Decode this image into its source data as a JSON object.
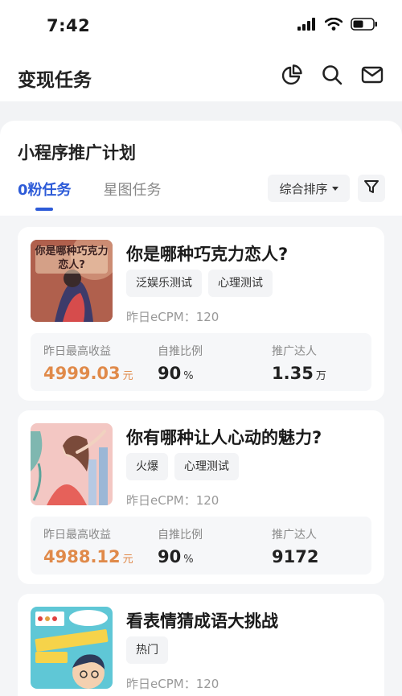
{
  "status_bar": {
    "time": "7:42"
  },
  "nav": {
    "title": "变现任务",
    "icons": [
      "chart-icon",
      "search-icon",
      "mail-icon"
    ]
  },
  "panel": {
    "title": "小程序推广计划",
    "tabs": [
      {
        "label": "0粉任务",
        "active": true
      },
      {
        "label": "星图任务",
        "active": false
      }
    ],
    "sort_label": "综合排序",
    "filter_icon": "filter-icon"
  },
  "colors": {
    "accent": "#2d5bd8",
    "earnings": "#e08a4a"
  },
  "stat_labels": {
    "max_earnings": "昨日最高收益",
    "ratio": "自推比例",
    "promoters": "推广达人"
  },
  "cards": [
    {
      "title": "你是哪种巧克力恋人?",
      "thumb_text": "你是哪种巧克力恋人?",
      "tags": [
        "泛娱乐测试",
        "心理测试"
      ],
      "ecpm": "昨日eCPM：120",
      "max_earnings": "4999.03",
      "max_earnings_unit": "元",
      "ratio": "90",
      "ratio_unit": "%",
      "promoters": "1.35",
      "promoters_unit": "万"
    },
    {
      "title": "你有哪种让人心动的魅力?",
      "tags": [
        "火爆",
        "心理测试"
      ],
      "ecpm": "昨日eCPM：120",
      "max_earnings": "4988.12",
      "max_earnings_unit": "元",
      "ratio": "90",
      "ratio_unit": "%",
      "promoters": "9172",
      "promoters_unit": ""
    },
    {
      "title": "看表情猜成语大挑战",
      "tags": [
        "热门"
      ],
      "ecpm": "昨日eCPM：120"
    }
  ]
}
